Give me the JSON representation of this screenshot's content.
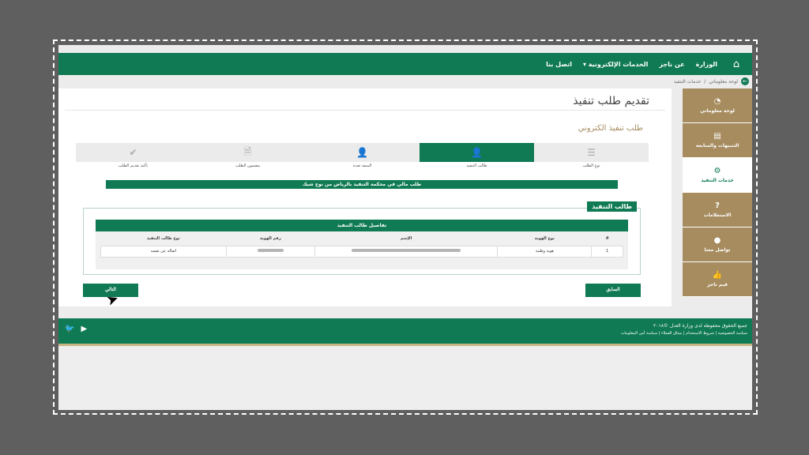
{
  "topnav": {
    "items": [
      "الوزارة",
      "عن ناجز",
      "الخدمات الإلكترونية ▾",
      "اتصل بنا"
    ]
  },
  "breadcrumb": {
    "items": [
      "لوحة معلوماتي",
      "خدمات التنفيذ"
    ],
    "sep": "/"
  },
  "sidebar": {
    "items": [
      {
        "label": "لوحة معلوماتي",
        "icon": "dashboard-icon"
      },
      {
        "label": "التنبيهات والمتابعة",
        "icon": "document-icon"
      },
      {
        "label": "خدمات التنفيذ",
        "icon": "gears-icon"
      },
      {
        "label": "الاستعلامات",
        "icon": "question-icon"
      },
      {
        "label": "تواصل معنا",
        "icon": "chat-icon"
      },
      {
        "label": "قيم ناجز",
        "icon": "thumbs-up-icon"
      }
    ]
  },
  "main": {
    "title": "تقديم طلب تنفيذ",
    "subtitle": "طلب تنفيذ الكتروني",
    "steps": [
      "نوع الطلب",
      "طالب التنفيذ",
      "المنفذ ضده",
      "مضمون الطلب",
      "تأكيد تقديم الطلب"
    ],
    "banner": "طلب مالي في محكمة التنفيذ بالرياض من نوع شيك",
    "fieldset_legend": "طالب التنفيذ",
    "panel_title": "تفاصيل طالب التنفيذ",
    "table": {
      "headers": [
        "#",
        "نوع الهوية",
        "الإسم",
        "رقم الهوية",
        "نوع طالب التنفيذ"
      ],
      "rows": [
        [
          "1",
          "هوية وطنية",
          "",
          "",
          "اصالة عن نفسه"
        ]
      ]
    },
    "prev_button": "السابق",
    "next_button": "التالي"
  },
  "footer": {
    "copyright": "جميع الحقوق محفوظة لدى وزارة العدل ©٢٠١٨",
    "links": "سياسة الخصوصية | شروط الاستخدام | ميثاق العملاء | سياسة أمن المعلومات",
    "social": [
      "twitter-icon",
      "youtube-icon"
    ]
  },
  "colors": {
    "primary": "#0f7a53",
    "gold": "#a68c5f"
  }
}
